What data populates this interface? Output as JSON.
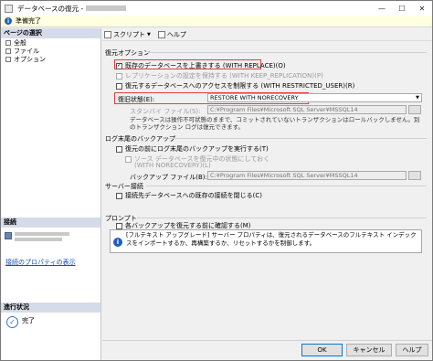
{
  "window": {
    "title": "データベースの復元 - ",
    "controls": [
      "—",
      "☐",
      "✕"
    ]
  },
  "status": {
    "text": "準備完了"
  },
  "left_panel": {
    "page_select_header": "ページの選択",
    "pages": [
      "全般",
      "ファイル",
      "オプション"
    ],
    "connection_header": "接続",
    "connection_link": "接続のプロパティの表示",
    "progress_header": "進行状況",
    "progress_status": "完了"
  },
  "toolbar": {
    "script_label": "スクリプト",
    "help_label": "ヘルプ"
  },
  "restore_options": {
    "header": "復元オプション",
    "overwrite": "既存のデータベースを上書きする (WITH REPLACE)(O)",
    "keep_replication": "レプリケーションの設定を保持する (WITH KEEP_REPLICATION)(P)",
    "restrict_access": "復元するデータベースへのアクセスを制限する (WITH RESTRICTED_USER)(R)",
    "recovery_state_label": "復旧状態(E):",
    "recovery_state_value": "RESTORE WITH NORECOVERY",
    "standby_label": "スタンバイ ファイル(S):",
    "standby_value": "C:¥Program Files¥Microsoft SQL Server¥MSSQL14",
    "recovery_note": "データベースは操作不可状態のままで、コミットされていないトランザクションはロールバックしません。別のトランザクション ログは復元できます。"
  },
  "tail_log": {
    "header": "ログ末尾のバックアップ",
    "take_tail_log": "復元の前にログ末尾のバックアップを実行する(T)",
    "leave_restoring_1": "ソース データベースを復元中の状態にしておく",
    "leave_restoring_2": "(WITH NORECOVERY)(L)",
    "backup_file_label": "バックアップ ファイル(B):",
    "backup_file_value": "C:¥Program Files¥Microsoft SQL Server¥MSSQL14"
  },
  "server_connections": {
    "header": "サーバー接続",
    "close_connections": "接続先データベースへの既存の接続を閉じる(C)"
  },
  "prompt": {
    "header": "プロンプト",
    "confirm": "各バックアップを復元する前に確認する(M)",
    "info_text": "[フルテキスト アップグレード] サーバー プロパティは、復元されるデータベースのフルテキスト インデックスをインポートするか、再構築するか、リセットするかを制御します。"
  },
  "footer": {
    "ok": "OK",
    "cancel": "キャンセル",
    "help": "ヘルプ"
  }
}
